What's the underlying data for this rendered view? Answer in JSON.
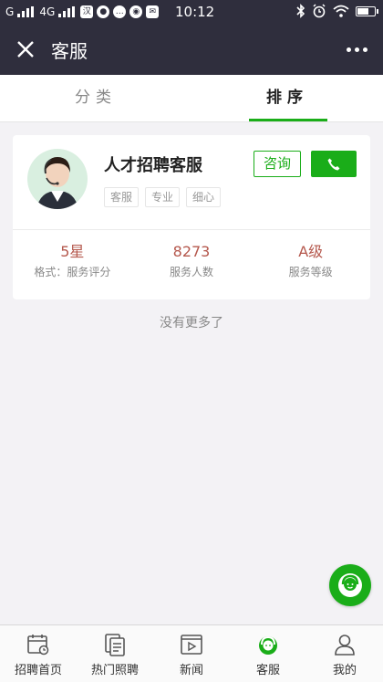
{
  "status_bar": {
    "signal_text": "G",
    "network": "4G",
    "time": "10:12"
  },
  "header": {
    "title": "客服",
    "close_icon": "close-icon",
    "more_icon": "more-icon"
  },
  "tabs": [
    {
      "label": "分类",
      "active": false
    },
    {
      "label": "排序",
      "active": true
    }
  ],
  "accent_color": "#1aad19",
  "card": {
    "name": "人才招聘客服",
    "tags": [
      "客服",
      "专业",
      "细心"
    ],
    "consult_label": "咨询",
    "phone_icon": "phone-icon",
    "stats": [
      {
        "value": "5星",
        "label": "格式：服务评分"
      },
      {
        "value": "8273",
        "label": "服务人数"
      },
      {
        "value": "A级",
        "label": "服务等级"
      }
    ]
  },
  "no_more_text": "没有更多了",
  "bottom_nav": [
    {
      "label": "招聘首页",
      "icon": "calendar-icon"
    },
    {
      "label": "热门照聘",
      "icon": "documents-icon"
    },
    {
      "label": "新闻",
      "icon": "video-icon"
    },
    {
      "label": "客服",
      "icon": "service-icon",
      "active": true
    },
    {
      "label": "我的",
      "icon": "user-icon"
    }
  ]
}
